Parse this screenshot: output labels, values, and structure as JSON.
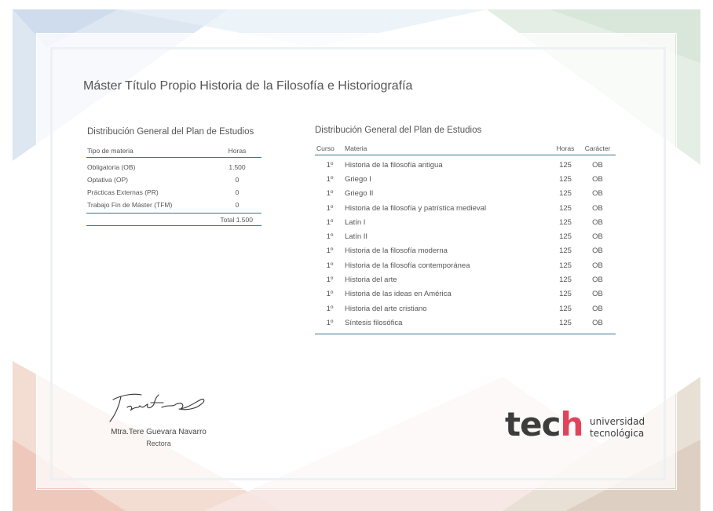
{
  "title": "Máster Título Propio Historia de la Filosofía e Historiografía",
  "general": {
    "title": "Distribución General del Plan de Estudios",
    "headers": {
      "type": "Tipo de materia",
      "hours": "Horas"
    },
    "rows": [
      {
        "type": "Obligatoria (OB)",
        "hours": "1.500"
      },
      {
        "type": "Optativa (OP)",
        "hours": "0"
      },
      {
        "type": "Prácticas Externas (PR)",
        "hours": "0"
      },
      {
        "type": "Trabajo Fin de Máster (TFM)",
        "hours": "0"
      }
    ],
    "total": "Total 1.500"
  },
  "plan": {
    "title": "Distribución General del Plan de Estudios",
    "headers": {
      "course": "Curso",
      "subject": "Materia",
      "hours": "Horas",
      "character": "Carácter"
    },
    "rows": [
      {
        "course": "1º",
        "subject": "Historia de la filosofía antigua",
        "hours": "125",
        "character": "OB"
      },
      {
        "course": "1º",
        "subject": "Griego I",
        "hours": "125",
        "character": "OB"
      },
      {
        "course": "1º",
        "subject": "Griego II",
        "hours": "125",
        "character": "OB"
      },
      {
        "course": "1º",
        "subject": "Historia de la filosofía y patrística medieval",
        "hours": "125",
        "character": "OB"
      },
      {
        "course": "1º",
        "subject": "Latín I",
        "hours": "125",
        "character": "OB"
      },
      {
        "course": "1º",
        "subject": "Latín II",
        "hours": "125",
        "character": "OB"
      },
      {
        "course": "1º",
        "subject": "Historia de la filosofía moderna",
        "hours": "125",
        "character": "OB"
      },
      {
        "course": "1º",
        "subject": "Historia de la filosofía contemporánea",
        "hours": "125",
        "character": "OB"
      },
      {
        "course": "1º",
        "subject": "Historia del arte",
        "hours": "125",
        "character": "OB"
      },
      {
        "course": "1º",
        "subject": "Historia de las ideas en América",
        "hours": "125",
        "character": "OB"
      },
      {
        "course": "1º",
        "subject": "Historia del arte cristiano",
        "hours": "125",
        "character": "OB"
      },
      {
        "course": "1º",
        "subject": "Síntesis filosófica",
        "hours": "125",
        "character": "OB"
      }
    ]
  },
  "signer": {
    "name": "Mtra.Tere Guevara Navarro",
    "role": "Rectora"
  },
  "logo": {
    "word": "tech",
    "line1": "universidad",
    "line2": "tecnológica"
  },
  "colors": {
    "rule": "#3a6f95",
    "logo_accent": "#e0445b"
  }
}
